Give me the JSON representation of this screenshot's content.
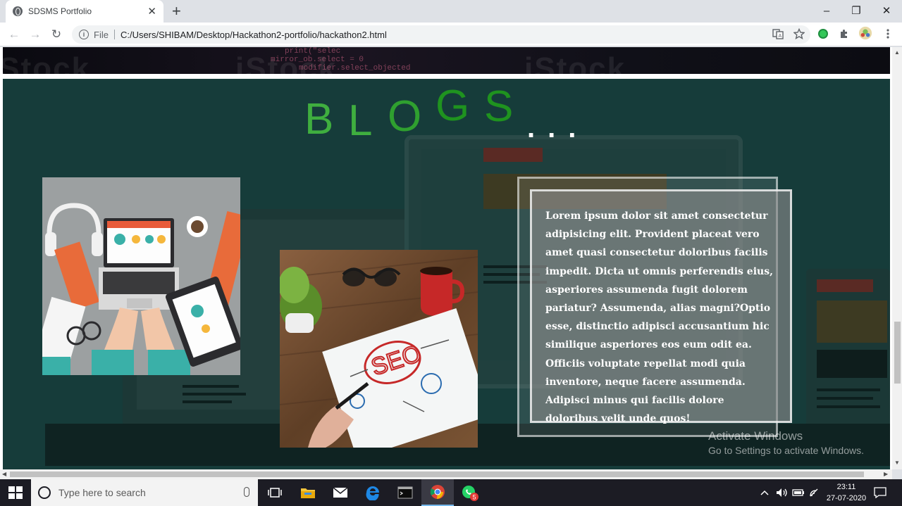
{
  "browser": {
    "tab": {
      "title": "SDSMS Portfolio",
      "close": "✕",
      "favicon": "globe-icon"
    },
    "new_tab": "+",
    "window_controls": {
      "minimize": "–",
      "maximize": "❐",
      "close": "✕"
    },
    "nav": {
      "back": "←",
      "forward": "→",
      "reload": "↻"
    },
    "address": {
      "info": "i",
      "scheme": "File",
      "url": "C:/Users/SHIBAM/Desktop/Hackathon2-portfolio/hackathon2.html"
    }
  },
  "page": {
    "hero_watermark": [
      "iStock",
      "iStock",
      "iStock"
    ],
    "hero_code": [
      "print(\"selec",
      "mirror_ob.select = 0",
      "modifier.select_objected"
    ],
    "blogs": {
      "title_letters": [
        "B",
        "L",
        "O",
        "G",
        "S"
      ],
      "title_dots": "...",
      "image1_alt": "laptop-workspace-illustration",
      "image2_alt": "seo-notebook-desk-photo",
      "text": "Lorem ipsum dolor sit amet consectetur adipisicing elit. Provident placeat vero amet quasi consectetur doloribus facilis impedit. Dicta ut omnis perferendis eius, asperiores assumenda fugit dolorem pariatur? Assumenda, alias magni?Optio esse, distinctio adipisci accusantium hic similique asperiores eos eum odit ea. Officiis voluptate repellat modi quia inventore, neque facere assumenda. Adipisci minus qui facilis dolore doloribus velit unde quos!"
    },
    "watermark": {
      "line1": "Activate Windows",
      "line2": "Go to Settings to activate Windows."
    }
  },
  "taskbar": {
    "search_placeholder": "Type here to search",
    "whatsapp_badge": "5",
    "clock_time": "23:11",
    "clock_date": "27-07-2020"
  },
  "colors": {
    "blogs_bg": "#163c3a",
    "title_green": "#3fae3f",
    "taskbar": "#1c1c24"
  }
}
